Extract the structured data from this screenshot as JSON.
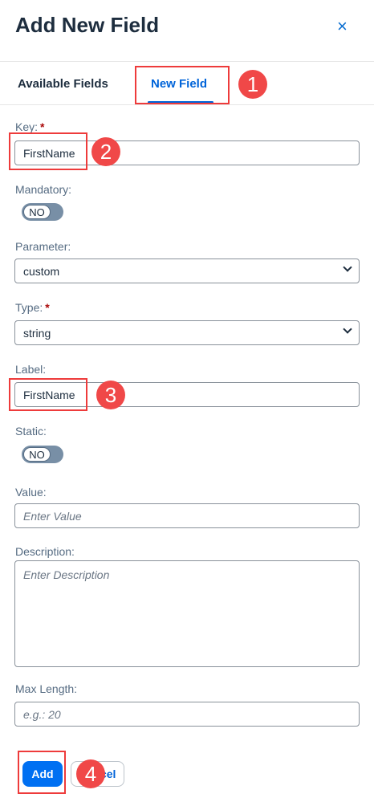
{
  "header": {
    "title": "Add New Field",
    "close": "×"
  },
  "tabs": [
    {
      "label": "Available Fields"
    },
    {
      "label": "New Field"
    }
  ],
  "form": {
    "key": {
      "label": "Key:",
      "value": "FirstName",
      "required": "*"
    },
    "mandatory": {
      "label": "Mandatory:",
      "toggle": "NO"
    },
    "parameter": {
      "label": "Parameter:",
      "value": "custom"
    },
    "type": {
      "label": "Type:",
      "value": "string",
      "required": "*"
    },
    "label": {
      "label": "Label:",
      "value": "FirstName"
    },
    "static": {
      "label": "Static:",
      "toggle": "NO"
    },
    "value": {
      "label": "Value:",
      "placeholder": "Enter Value"
    },
    "description": {
      "label": "Description:",
      "placeholder": "Enter Description"
    },
    "max_length": {
      "label": "Max Length:",
      "placeholder": "e.g.: 20"
    }
  },
  "buttons": {
    "add": "Add",
    "cancel": "Cancel"
  },
  "annotations": [
    "1",
    "2",
    "3",
    "4"
  ]
}
